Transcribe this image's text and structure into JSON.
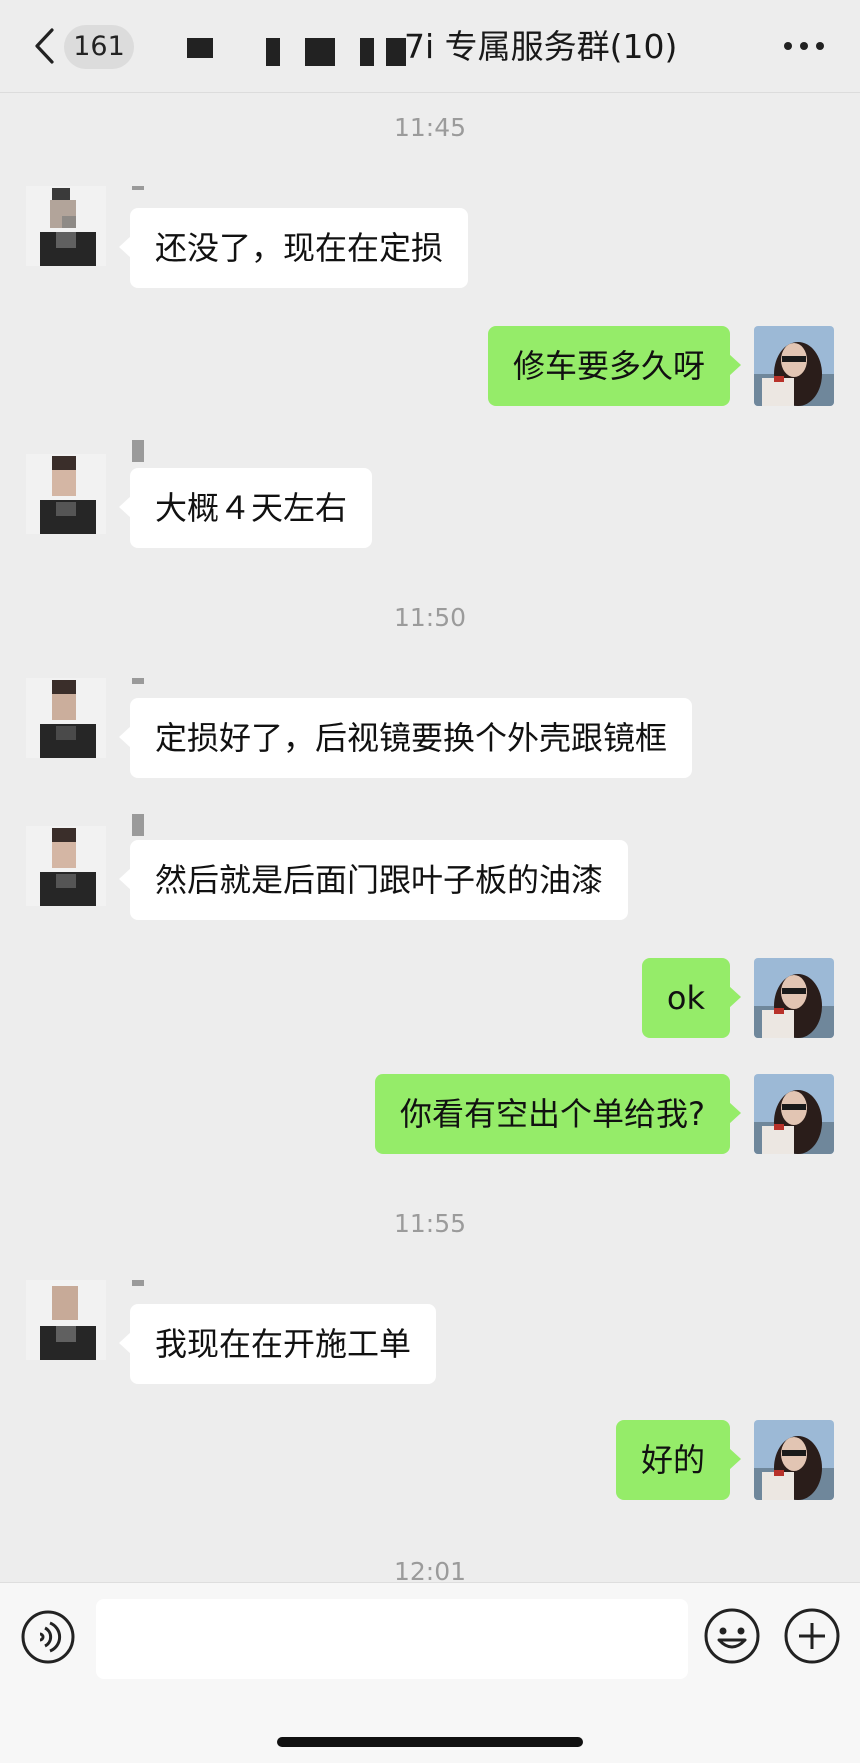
{
  "navbar": {
    "unread_count": "161",
    "title": "7i  专属服务群(10)"
  },
  "messages": [
    {
      "time": "11:45"
    },
    {
      "side": "in",
      "text": "还没了，现在在定损"
    },
    {
      "side": "out",
      "text": "修车要多久呀"
    },
    {
      "side": "in",
      "text": "大概４天左右"
    },
    {
      "time": "11:50"
    },
    {
      "side": "in",
      "text": "定损好了，后视镜要换个外壳跟镜框"
    },
    {
      "side": "in",
      "text": "然后就是后面门跟叶子板的油漆"
    },
    {
      "side": "out",
      "text": "ok"
    },
    {
      "side": "out",
      "text": "你看有空出个单给我?"
    },
    {
      "time": "11:55"
    },
    {
      "side": "in",
      "text": "我现在在开施工单"
    },
    {
      "side": "out",
      "text": "好的"
    },
    {
      "time": "12:01"
    }
  ],
  "input": {
    "placeholder": ""
  },
  "icons": {
    "back": "chevron-left-icon",
    "more": "more-dots-icon",
    "voice": "voice-icon",
    "emoji": "emoji-icon",
    "plus": "plus-icon"
  },
  "colors": {
    "background": "#ededed",
    "incoming_bubble": "#ffffff",
    "outgoing_bubble": "#95ec69",
    "timestamp": "#9b9b9b"
  }
}
